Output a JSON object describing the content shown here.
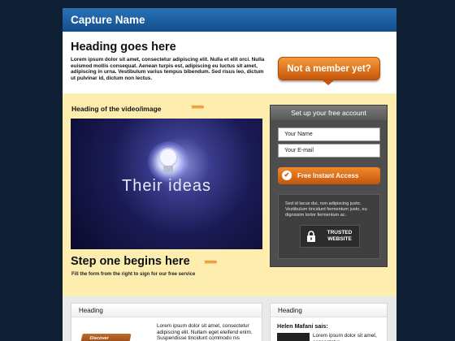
{
  "topbar": {
    "title": "Capture Name"
  },
  "intro": {
    "heading": "Heading goes here",
    "body": "Lorem ipsum dolor sit amet, consectetur adipiscing elit. Nulla et elit orci. Nulla euismod mollis consequat. Aenean turpis est, adipiscing eu luctus sit amet, adipiscing in urna. Vestibulum varius tempus bibendum. Sed risus leo, dictum ut pulvinar id, dictum non lectus.",
    "member_button": "Not a member yet?"
  },
  "hero": {
    "video_heading": "Heading of the video/image",
    "video_text": "Their ideas",
    "arrows": "››››››››››",
    "step_title": "Step one begins here",
    "step_sub": "Fill the form from the right to sign for our free service"
  },
  "form": {
    "heading": "Set up your free account",
    "name_placeholder": "Your Name",
    "email_placeholder": "Your E-mail",
    "submit_label": "Free Instant Access",
    "note": "Sed id lacus dui, non adipiscing justo. Vestibulum tincidunt fermentum justo, eu dignissim tortor fermentum ac.",
    "trusted_label": "TRUSTED WEBSITE"
  },
  "bottom": {
    "left_heading": "Heading",
    "left_text": "Lorem ipsum dolor sit amet, consectetur adipiscing elit. Nullam eget eleifend enim. Suspendisse tincidunt commodo nis",
    "book_label": "Discover",
    "right_heading": "Heading",
    "testimonial_name": "Helen Mafani sais:",
    "testimonial_text": "Lorem ipsum dolor sit amet, consectetur"
  },
  "colors": {
    "accent": "#e9781f",
    "header_blue": "#1a5ea3",
    "hero_bg": "#fdeeb0"
  }
}
